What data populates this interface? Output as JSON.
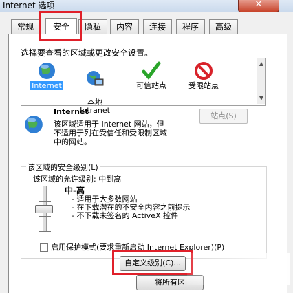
{
  "window": {
    "title": "Internet 选项",
    "close_label": "✕"
  },
  "tabs": [
    {
      "label": "常规"
    },
    {
      "label": "安全"
    },
    {
      "label": "隐私"
    },
    {
      "label": "内容"
    },
    {
      "label": "连接"
    },
    {
      "label": "程序"
    },
    {
      "label": "高级"
    }
  ],
  "active_tab": "安全",
  "security": {
    "select_zone_text": "选择要查看的区域或更改安全设置。",
    "zones": [
      {
        "label": "Internet",
        "icon": "globe-icon"
      },
      {
        "label": "本地\nIntranet",
        "icon": "intranet-icon"
      },
      {
        "label": "可信站点",
        "icon": "checkmark-icon"
      },
      {
        "label": "受限站点",
        "icon": "restricted-icon"
      }
    ],
    "selected_zone": "Internet",
    "zone_title": "Internet",
    "zone_description": "该区域适用于 Internet 网站，但\n不适用于列在受信任和受限制区域\n中的网站。",
    "sites_button": "站点(S)",
    "group_label": "该区域的安全级别(L)",
    "allowed_levels": "该区域的允许级别: 中到高",
    "level_name": "中-高",
    "bullets": [
      "- 适用于大多数网站",
      "- 在下载潜在的不安全内容之前提示",
      "- 不下载未签名的 ActiveX 控件"
    ],
    "protected_mode": {
      "label": "启用保护模式(要求重新启动 Internet Explorer)(P)",
      "checked": false
    },
    "custom_level_button": "自定义级别(C)...",
    "reset_all_button": "将所有区"
  },
  "colors": {
    "highlight": "#e0202a",
    "selection": "#3399ff"
  }
}
